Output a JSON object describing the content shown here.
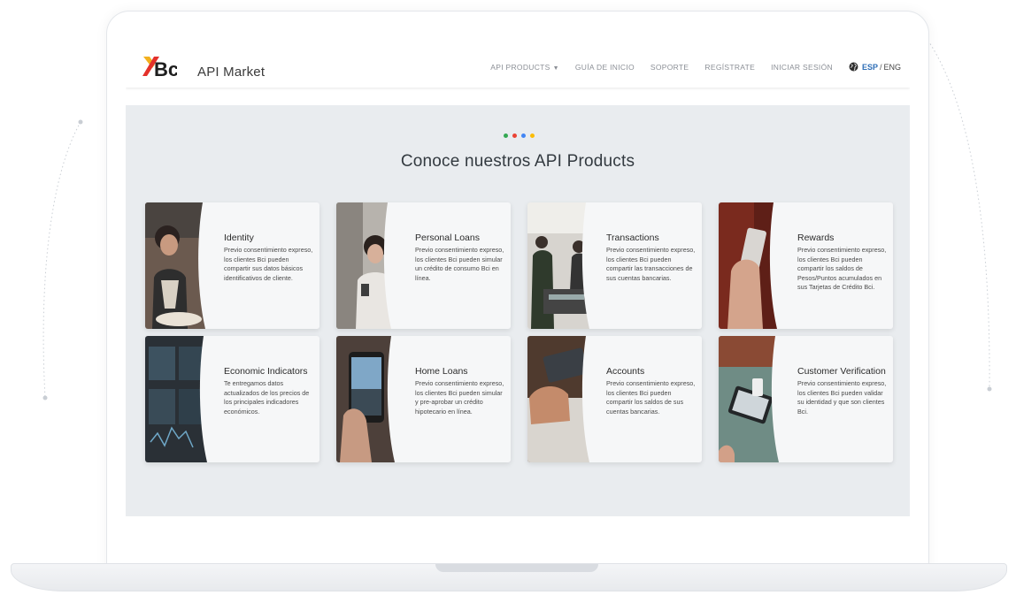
{
  "header": {
    "brand_text": "API Market",
    "nav": [
      {
        "label": "API PRODUCTS"
      },
      {
        "label": "GUÍA DE INICIO"
      },
      {
        "label": "SOPORTE"
      },
      {
        "label": "REGÍSTRATE"
      },
      {
        "label": "INICIAR SESIÓN"
      }
    ],
    "lang": {
      "esp": "ESP",
      "separator": "/",
      "eng": "ENG"
    }
  },
  "section": {
    "title": "Conoce nuestros API Products",
    "dot_colors": [
      "#34a853",
      "#ea4335",
      "#4285f4",
      "#fbbc05"
    ]
  },
  "products": [
    {
      "title": "Identity",
      "desc": "Previo consentimiento expreso, los clientes Bci pueden compartir sus datos básicos identificativos de cliente."
    },
    {
      "title": "Personal Loans",
      "desc": "Previo consentimiento expreso, los clientes Bci pueden simular un crédito de consumo Bci en línea."
    },
    {
      "title": "Transactions",
      "desc": "Previo consentimiento expreso, los clientes Bci pueden compartir las transacciones de sus cuentas bancarias."
    },
    {
      "title": "Rewards",
      "desc": "Previo consentimiento expreso, los clientes Bci pueden compartir los saldos de Pesos/Puntos acumulados en sus Tarjetas de Crédito Bci."
    },
    {
      "title": "Economic Indicators",
      "desc": "Te entregamos datos actualizados de los precios de los principales indicadores económicos."
    },
    {
      "title": "Home Loans",
      "desc": "Previo consentimiento expreso, los clientes Bci pueden simular y pre-aprobar un crédito hipotecario en línea."
    },
    {
      "title": "Accounts",
      "desc": "Previo consentimiento expreso, los clientes Bci pueden compartir los saldos de sus cuentas bancarias."
    },
    {
      "title": "Customer Verification",
      "desc": "Previo consentimiento expreso, los clientes Bci pueden validar su identidad y que son clientes Bci."
    }
  ],
  "colors": {
    "accent_blue": "#2f6fb7",
    "logo_red": "#e4312b",
    "logo_yellow": "#f2b01e",
    "section_bg": "#e9ecef"
  }
}
